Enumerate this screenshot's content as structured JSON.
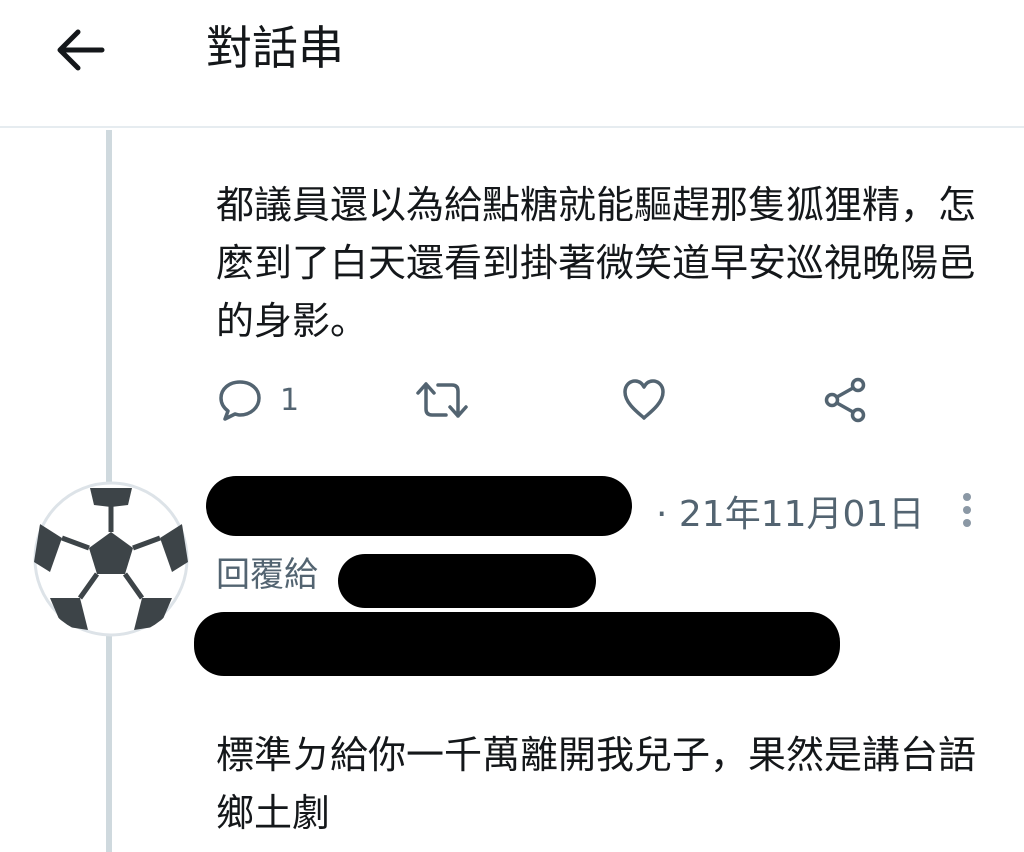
{
  "header": {
    "title": "對話串",
    "back_icon": "arrow-left-icon"
  },
  "tweet": {
    "text": "都議員還以為給點糖就能驅趕那隻狐狸精，怎麼到了白天還看到掛著微笑道早安巡視晚陽邑的身影。",
    "reply_count": "1"
  },
  "reply": {
    "date": "· 21年11月01日",
    "reply_to_label": "回覆給",
    "text": "標準ㄉ給你一千萬離開我兒子，果然是講台語鄉土劇"
  },
  "colors": {
    "text": "#14171a",
    "muted": "#536471",
    "divider": "#e6ecf0",
    "thread_line": "#cfd9de"
  }
}
